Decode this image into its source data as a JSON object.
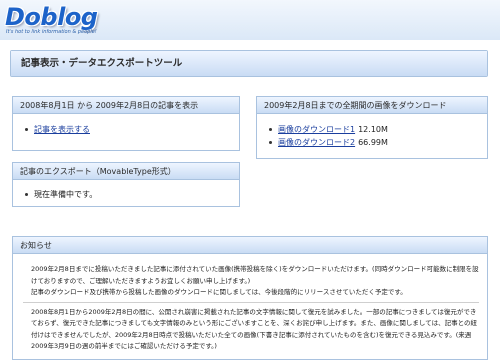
{
  "header": {
    "logo_text": "Doblog",
    "tagline": "It's hot to link information & people!"
  },
  "page_title": "記事表示・データエクスポートツール",
  "panels": {
    "articles": {
      "title": "2008年8月1日 から 2009年2月8日の記事を表示",
      "link_label": "記事を表示する"
    },
    "images": {
      "title": "2009年2月8日までの全期間の画像をダウンロード",
      "items": [
        {
          "label": "画像のダウンロード1",
          "size": "12.10M"
        },
        {
          "label": "画像のダウンロード2",
          "size": "66.99M"
        }
      ]
    },
    "export": {
      "title": "記事のエクスポート（MovableType形式）",
      "status": "現在準備中です。"
    },
    "notice": {
      "title": "お知らせ",
      "paragraph1": "2009年2月8日までに投稿いただきました記事に添付されていた画像(携帯投稿を除く)をダウンロードいただけます。(同時ダウンロード可能数に制限を設けておりますので、ご理解いただきますようお宜しくお願い申し上げます。)",
      "paragraph2": "記事のダウンロード及び携帯から投稿した画像のダウンロードに関しましては、今後段階的にリリースさせていただく予定です。",
      "paragraph3": "2008年8月1日から2009年2月8日の間に、公開され崩害に掲載された記事の文字情報に関して復元を試みました。一部の記事につきましては復元ができておらず、復元できた記事につきましても文字情報のみという形にございますことを、深くお詫び申し上げます。また、画像に関しましては、記事との紐付けはできませんでしたが、2009年2月8日時点で投稿いただいた全ての画像(下書き記事に添付されていたものを含む)を復元できる見込みです。(来週2009年3月9日の週の前半までにはご確認いただける予定です。)"
    }
  }
}
